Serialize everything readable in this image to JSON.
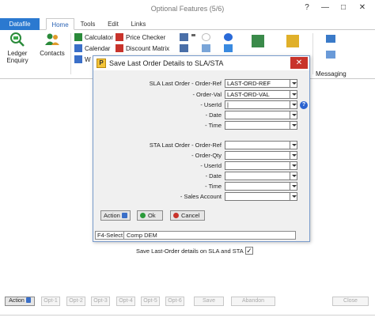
{
  "window": {
    "title": "Optional Features (5/6)",
    "help": "?",
    "minimize": "—",
    "maximize": "□",
    "close": "✕"
  },
  "tabs": [
    "Datafile",
    "Home",
    "Tools",
    "Edit",
    "Links"
  ],
  "ribbon": {
    "ledger_enquiry": "Ledger\nEnquiry",
    "contacts": "Contacts",
    "calculator": "Calculator",
    "calendar": "Calendar",
    "w_item": "W",
    "price_checker": "Price Checker",
    "discount_matrix": "Discount Matrix",
    "messaging": "Messaging"
  },
  "dialog": {
    "title": "Save Last Order Details to SLA/STA",
    "p_icon": "P",
    "close": "✕",
    "sla_label": "SLA Last Order - Order-Ref",
    "sla_fields": [
      {
        "label": "SLA Last Order - Order-Ref",
        "value": "LAST-ORD-REF"
      },
      {
        "label": "- Order-Val",
        "value": "LAST-ORD-VAL"
      },
      {
        "label": "- UserId",
        "value": "|"
      },
      {
        "label": "- Date",
        "value": ""
      },
      {
        "label": "- Time",
        "value": ""
      }
    ],
    "sta_fields": [
      {
        "label": "STA Last Order - Order-Ref",
        "value": ""
      },
      {
        "label": "- Order-Qty",
        "value": ""
      },
      {
        "label": "- UserId",
        "value": ""
      },
      {
        "label": "- Date",
        "value": ""
      },
      {
        "label": "- Time",
        "value": ""
      },
      {
        "label": "- Sales Account",
        "value": ""
      }
    ],
    "help": "?",
    "buttons": {
      "action": "Action",
      "ok": "Ok",
      "cancel": "Cancel"
    },
    "status": {
      "key": "F4-Select",
      "message": "Comp DEM"
    }
  },
  "confirm": {
    "text": "Save Last-Order details on SLA and STA ?",
    "check": "✓"
  },
  "toolbar": {
    "action": "Action",
    "opt1": "Opt-1",
    "opt2": "Opt-2",
    "opt3": "Opt-3",
    "opt4": "Opt-4",
    "opt5": "Opt-5",
    "opt6": "Opt-6",
    "save": "Save",
    "abandon": "Abandon",
    "close": "Close"
  }
}
